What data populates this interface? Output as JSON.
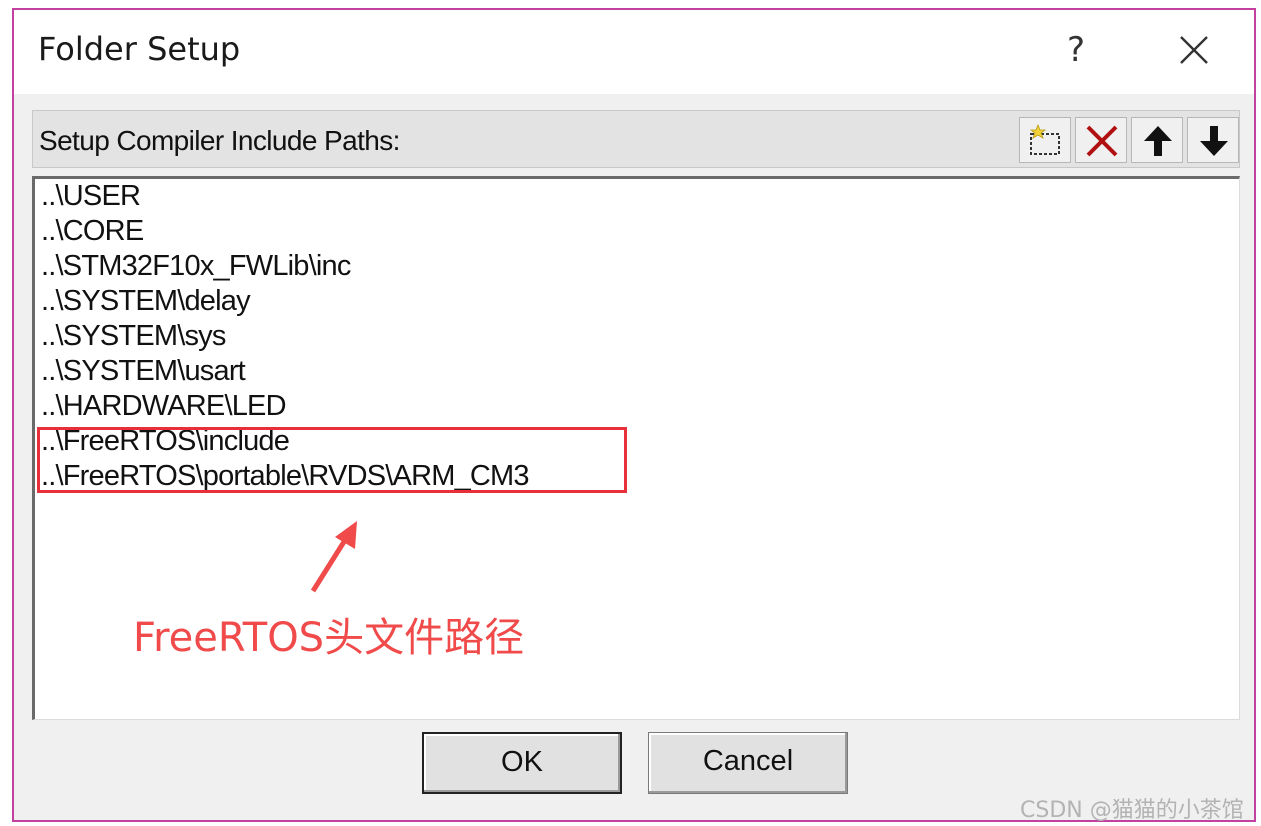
{
  "window": {
    "title": "Folder Setup",
    "help_label": "?",
    "close_icon": "close-icon"
  },
  "toolbar": {
    "label": "Setup Compiler Include Paths:",
    "buttons": [
      {
        "name": "new-folder-button",
        "icon": "new-folder-icon"
      },
      {
        "name": "delete-button",
        "icon": "delete-x-icon",
        "color": "#b01010"
      },
      {
        "name": "move-up-button",
        "icon": "arrow-up-icon"
      },
      {
        "name": "move-down-button",
        "icon": "arrow-down-icon"
      }
    ]
  },
  "paths": [
    "..\\USER",
    "..\\CORE",
    "..\\STM32F10x_FWLib\\inc",
    "..\\SYSTEM\\delay",
    "..\\SYSTEM\\sys",
    "..\\SYSTEM\\usart",
    "..\\HARDWARE\\LED",
    "..\\FreeRTOS\\include",
    "..\\FreeRTOS\\portable\\RVDS\\ARM_CM3"
  ],
  "annotation": {
    "text": "FreeRTOS头文件路径",
    "color": "#f04a4a"
  },
  "buttons": {
    "ok": "OK",
    "cancel": "Cancel"
  },
  "watermark": "CSDN @猫猫的小茶馆"
}
